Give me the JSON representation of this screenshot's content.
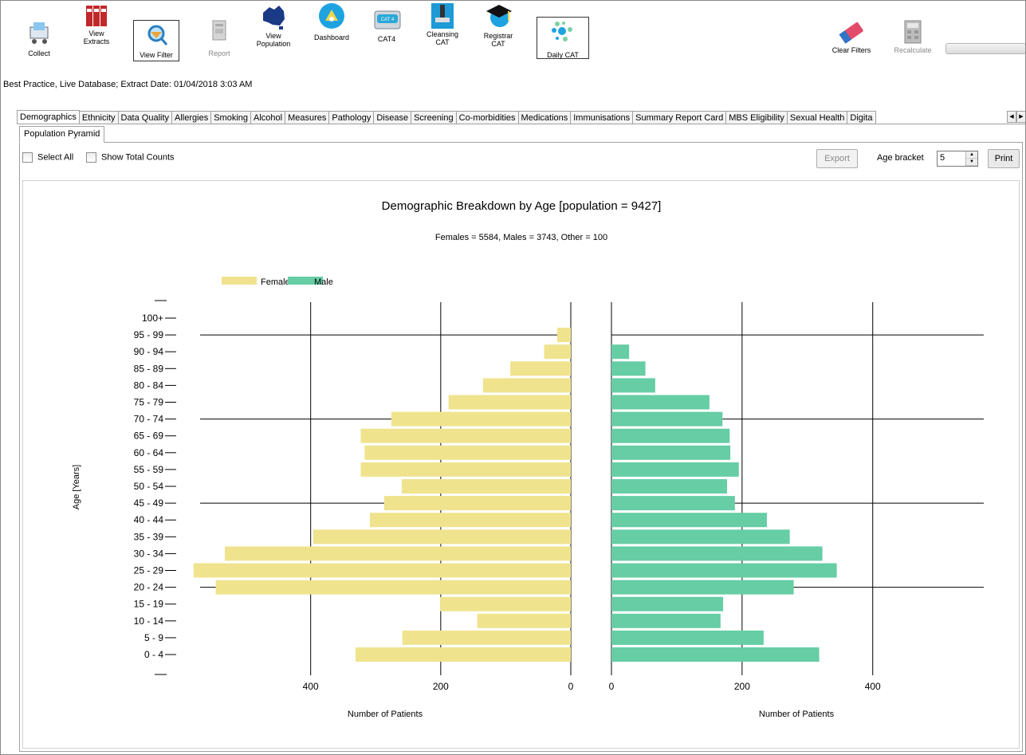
{
  "toolbar": {
    "items": [
      {
        "label": "Collect",
        "icon": "cart-icon"
      },
      {
        "label": "View\nExtracts",
        "icon": "binders-icon"
      },
      {
        "label": "View Filter",
        "icon": "filter-magnifier-icon"
      },
      {
        "label": "Report",
        "icon": "report-icon"
      },
      {
        "label": "View\nPopulation",
        "icon": "australia-map-icon"
      },
      {
        "label": "Dashboard",
        "icon": "dashboard-gauge-icon"
      },
      {
        "label": "CAT4",
        "icon": "cat4-icon"
      },
      {
        "label": "Cleansing\nCAT",
        "icon": "cleansing-icon"
      },
      {
        "label": "Registrar\nCAT",
        "icon": "graduation-cap-icon"
      },
      {
        "label": "Daily CAT",
        "icon": "dots-icon"
      },
      {
        "label": "Clear Filters",
        "icon": "eraser-icon"
      },
      {
        "label": "Recalculate",
        "icon": "calculator-icon"
      }
    ]
  },
  "status_line": "Best Practice, Live Database; Extract Date: 01/04/2018 3:03 AM",
  "tabs": [
    "Demographics",
    "Ethnicity",
    "Data Quality",
    "Allergies",
    "Smoking",
    "Alcohol",
    "Measures",
    "Pathology",
    "Disease",
    "Screening",
    "Co-morbidities",
    "Medications",
    "Immunisations",
    "Summary Report Card",
    "MBS Eligibility",
    "Sexual Health",
    "Digita"
  ],
  "active_tab": "Demographics",
  "subtab": "Population Pyramid",
  "controls": {
    "select_all": "Select All",
    "show_total_counts": "Show Total Counts",
    "export": "Export",
    "age_bracket_label": "Age bracket",
    "age_bracket_value": "5",
    "print": "Print"
  },
  "colors": {
    "female": "#f0e38e",
    "male": "#66cda5"
  },
  "chart_data": {
    "type": "bar",
    "title": "Demographic Breakdown by Age [population = 9427]",
    "subtitle": "Females = 5584, Males = 3743, Other = 100",
    "ylabel": "Age [Years]",
    "xlabel": "Number of Patients",
    "legend": "top-left",
    "grid": true,
    "categories": [
      "100+",
      "95 - 99",
      "90 - 94",
      "85 - 89",
      "80 - 84",
      "75 - 79",
      "70 - 74",
      "65 - 69",
      "60 - 64",
      "55 - 59",
      "50 - 54",
      "45 - 49",
      "40 - 44",
      "35 - 39",
      "30 - 34",
      "25 - 29",
      "20 - 24",
      "15 - 19",
      "10 - 14",
      "5 - 9",
      "0 - 4"
    ],
    "series": [
      {
        "name": "Female",
        "values": [
          0,
          21,
          41,
          93,
          135,
          188,
          276,
          323,
          317,
          323,
          260,
          287,
          309,
          396,
          532,
          580,
          546,
          201,
          144,
          259,
          331
        ]
      },
      {
        "name": "Male",
        "values": [
          0,
          0,
          27,
          52,
          67,
          150,
          170,
          181,
          182,
          195,
          177,
          189,
          238,
          273,
          323,
          345,
          279,
          171,
          167,
          233,
          318
        ]
      }
    ],
    "female_ticks": [
      "400",
      "200",
      "0"
    ],
    "male_ticks": [
      "0",
      "200",
      "400"
    ],
    "xlim": [
      0,
      570
    ]
  }
}
